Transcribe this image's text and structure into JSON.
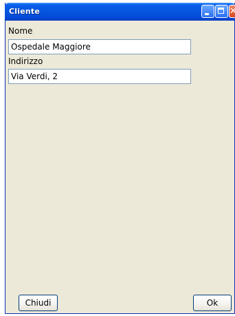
{
  "window": {
    "title": "Cliente"
  },
  "titlebar": {
    "minimize_icon": "minimize-icon",
    "maximize_icon": "maximize-icon",
    "close_icon": "close-icon"
  },
  "form": {
    "nome_label": "Nome",
    "nome_value": "Ospedale Maggiore",
    "indirizzo_label": "Indirizzo",
    "indirizzo_value": "Via Verdi, 2"
  },
  "buttons": {
    "close_label": "Chiudi",
    "ok_label": "Ok"
  }
}
